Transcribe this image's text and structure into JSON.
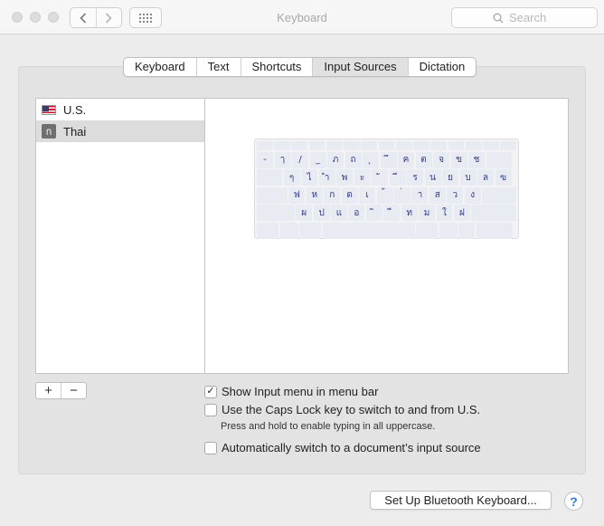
{
  "window": {
    "title": "Keyboard",
    "search_placeholder": "Search"
  },
  "tabs": [
    {
      "label": "Keyboard",
      "active": false
    },
    {
      "label": "Text",
      "active": false
    },
    {
      "label": "Shortcuts",
      "active": false
    },
    {
      "label": "Input Sources",
      "active": true
    },
    {
      "label": "Dictation",
      "active": false
    }
  ],
  "sources": [
    {
      "label": "U.S.",
      "icon": "us-flag-icon",
      "selected": false
    },
    {
      "label": "Thai",
      "icon": "thai-input-icon",
      "badge": "ก",
      "selected": true
    }
  ],
  "keyboard_preview": {
    "rows": [
      [
        "",
        "",
        "",
        "",
        "",
        "",
        "",
        "",
        "",
        "",
        "",
        "",
        "",
        "",
        ""
      ],
      [
        "-",
        "ๅ",
        "/",
        "_",
        "ภ",
        "ถ",
        "ุ",
        "ึ",
        "ค",
        "ต",
        "จ",
        "ข",
        "ช",
        ""
      ],
      [
        "",
        "ๆ",
        "ไ",
        "ำ",
        "พ",
        "ะ",
        "ั",
        "ี",
        "ร",
        "น",
        "ย",
        "บ",
        "ล",
        "ฃ"
      ],
      [
        "",
        "ฟ",
        "ห",
        "ก",
        "ด",
        "เ",
        "้",
        "่",
        "า",
        "ส",
        "ว",
        "ง",
        ""
      ],
      [
        "",
        "ผ",
        "ป",
        "แ",
        "อ",
        "ิ",
        "ื",
        "ท",
        "ม",
        "ใ",
        "ฝ",
        ""
      ],
      [
        "",
        "",
        "",
        "",
        "",
        "",
        "",
        ""
      ]
    ]
  },
  "controls": {
    "add_label": "+",
    "remove_label": "−"
  },
  "options": {
    "show_menu": {
      "label": "Show Input menu in menu bar",
      "checked": true
    },
    "caps_lock": {
      "label": "Use the Caps Lock key to switch to and from U.S.",
      "checked": false
    },
    "caps_hint": "Press and hold to enable typing in all uppercase.",
    "auto_switch": {
      "label": "Automatically switch to a document’s input source",
      "checked": false
    }
  },
  "footer": {
    "bluetooth_label": "Set Up Bluetooth Keyboard...",
    "help_label": "?"
  },
  "colors": {
    "key_text": "#303a8e",
    "help_accent": "#3a78d6"
  }
}
